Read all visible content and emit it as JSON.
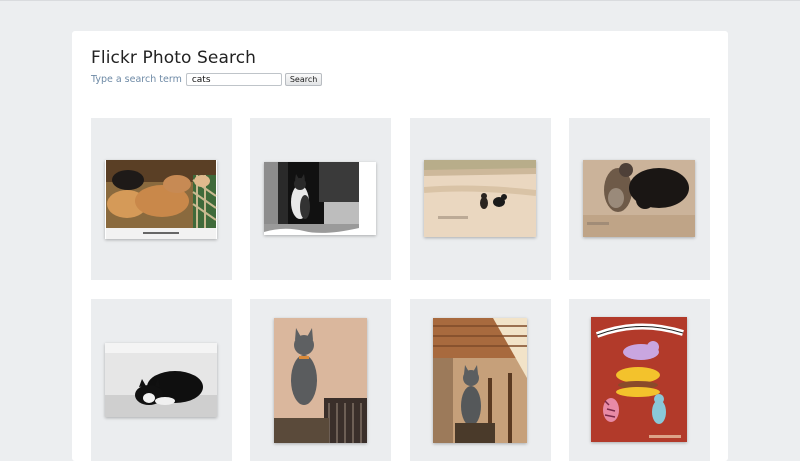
{
  "app": {
    "title": "Flickr Photo Search"
  },
  "search": {
    "label": "Type a search term",
    "value": "cats",
    "button_label": "Search"
  },
  "results": [
    {
      "subject": "cats-sleeping-on-blanket-photo"
    },
    {
      "subject": "black-white-cat-in-doorway-photo"
    },
    {
      "subject": "two-cats-walking-on-path-photo"
    },
    {
      "subject": "two-cats-on-ground-photo"
    },
    {
      "subject": "black-white-cat-lying-photo"
    },
    {
      "subject": "grey-cat-sitting-photo"
    },
    {
      "subject": "grey-cat-on-porch-photo"
    },
    {
      "subject": "alright-cats-poster-illustration"
    }
  ]
}
